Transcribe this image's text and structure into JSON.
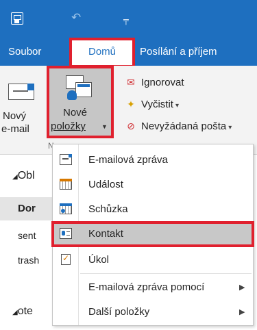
{
  "titlebar": {
    "icons": [
      "save-icon",
      "undo-icon",
      "customize-qat-icon"
    ],
    "more_glyph": "╤"
  },
  "tabs": [
    {
      "label": "Soubor"
    },
    {
      "label": "Domů"
    },
    {
      "label": "Posílání a příjem"
    }
  ],
  "ribbon": {
    "new_email": {
      "line1": "Nový",
      "line2": "e-mail"
    },
    "group_label": "N",
    "new_items": {
      "line1": "Nové",
      "line2": "položky"
    },
    "ignore": "Ignorovat",
    "clean_up": "Vyčistit",
    "junk": "Nevyžádaná pošta"
  },
  "folders": {
    "section1": "Obl",
    "inbox": "Dor",
    "sent": "sent",
    "trash": "trash",
    "section2": "ote"
  },
  "menu": {
    "items": [
      {
        "label": "E-mailová zpráva",
        "icon": "email-message-icon"
      },
      {
        "label": "Událost",
        "icon": "event-calendar-icon"
      },
      {
        "label": "Schůzka",
        "icon": "meeting-icon"
      },
      {
        "label": "Kontakt",
        "icon": "contact-card-icon"
      },
      {
        "label": "Úkol",
        "icon": "task-icon"
      },
      {
        "label": "E-mailová zpráva pomocí"
      },
      {
        "label": "Další položky"
      }
    ],
    "highlighted": "Kontakt"
  },
  "colors": {
    "accent": "#1e6fbf",
    "highlight_outline": "#e0202e",
    "hover_gray": "#c8c8c8"
  }
}
